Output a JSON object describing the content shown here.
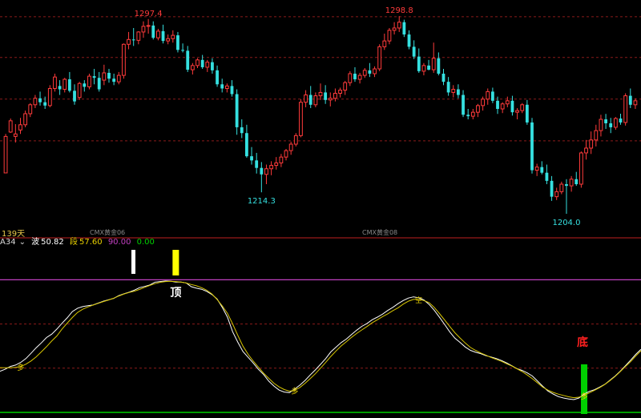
{
  "colors": {
    "up": "#ff3b3b",
    "down": "#35e0e0",
    "wave": "#ffffff",
    "segment": "#d8c600",
    "level90": "#c040c0",
    "level0": "#00d000",
    "grid": "#8b1a1a"
  },
  "header": {
    "indicator_name": "A34",
    "wave_label": "波",
    "wave_value": "50.82",
    "segment_label": "段",
    "segment_value": "57.60",
    "level_high": "90.00",
    "level_low": "0.00"
  },
  "labels": {
    "days": "139天",
    "contract_1": "CMX黄金06",
    "contract_2": "CMX黄金08",
    "top_marker": "顶",
    "bottom_marker": "底",
    "marker_duo": "多",
    "marker_kong": "空"
  },
  "chart_data": [
    {
      "type": "candlestick",
      "title": "",
      "annotations": [
        {
          "label": "1297.4",
          "index": 29,
          "kind": "high"
        },
        {
          "label": "1298.8",
          "index": 80,
          "kind": "high"
        },
        {
          "label": "1214.3",
          "index": 52,
          "kind": "low"
        },
        {
          "label": "1204.0",
          "index": 114,
          "kind": "low"
        }
      ],
      "ylim": [
        1199,
        1305
      ],
      "grid_levels": [
        1298.5,
        1279,
        1259,
        1239
      ],
      "candles": [
        [
          1223.6,
          1242.3,
          1223.6,
          1241.1
        ],
        [
          1243.2,
          1249.7,
          1242.8,
          1248.6
        ],
        [
          1241.1,
          1247.0,
          1238.2,
          1242.3
        ],
        [
          1244.2,
          1250.0,
          1242.3,
          1246.7
        ],
        [
          1246.7,
          1253.5,
          1245.5,
          1252.0
        ],
        [
          1252.0,
          1257.1,
          1250.4,
          1256.3
        ],
        [
          1256.3,
          1261.0,
          1254.7,
          1259.4
        ],
        [
          1259.4,
          1262.6,
          1255.9,
          1257.5
        ],
        [
          1257.5,
          1260.2,
          1254.3,
          1255.9
        ],
        [
          1255.9,
          1265.7,
          1255.1,
          1264.1
        ],
        [
          1264.1,
          1271.2,
          1262.6,
          1269.6
        ],
        [
          1265.3,
          1268.1,
          1261.0,
          1263.7
        ],
        [
          1263.7,
          1269.2,
          1262.2,
          1268.5
        ],
        [
          1268.5,
          1272.0,
          1262.2,
          1263.0
        ],
        [
          1263.0,
          1266.1,
          1256.3,
          1257.9
        ],
        [
          1259.8,
          1267.3,
          1258.6,
          1266.5
        ],
        [
          1266.5,
          1268.1,
          1262.6,
          1264.9
        ],
        [
          1264.9,
          1271.2,
          1263.7,
          1270.0
        ],
        [
          1270.0,
          1273.5,
          1266.1,
          1269.2
        ],
        [
          1269.2,
          1272.0,
          1262.6,
          1263.7
        ],
        [
          1268.1,
          1275.5,
          1265.7,
          1271.6
        ],
        [
          1271.6,
          1273.5,
          1266.9,
          1268.8
        ],
        [
          1268.8,
          1271.2,
          1265.7,
          1267.3
        ],
        [
          1267.3,
          1272.0,
          1266.1,
          1270.4
        ],
        [
          1270.4,
          1285.7,
          1268.8,
          1285.3
        ],
        [
          1285.3,
          1291.2,
          1282.9,
          1287.6
        ],
        [
          1287.6,
          1293.1,
          1284.5,
          1287.2
        ],
        [
          1287.2,
          1291.6,
          1285.3,
          1291.2
        ],
        [
          1291.2,
          1296.3,
          1288.4,
          1293.9
        ],
        [
          1293.9,
          1297.4,
          1290.4,
          1294.3
        ],
        [
          1294.3,
          1296.3,
          1287.6,
          1288.4
        ],
        [
          1288.4,
          1292.7,
          1287.2,
          1291.6
        ],
        [
          1291.6,
          1294.7,
          1285.7,
          1286.9
        ],
        [
          1286.9,
          1290.0,
          1285.3,
          1288.0
        ],
        [
          1288.0,
          1292.0,
          1286.1,
          1289.6
        ],
        [
          1289.6,
          1291.2,
          1281.4,
          1282.6
        ],
        [
          1282.6,
          1285.7,
          1281.4,
          1282.2
        ],
        [
          1282.2,
          1284.5,
          1272.0,
          1273.1
        ],
        [
          1273.1,
          1276.3,
          1270.8,
          1275.1
        ],
        [
          1275.1,
          1278.6,
          1273.9,
          1277.8
        ],
        [
          1277.8,
          1280.2,
          1273.5,
          1274.3
        ],
        [
          1274.3,
          1277.8,
          1272.0,
          1276.7
        ],
        [
          1276.7,
          1278.6,
          1271.2,
          1272.8
        ],
        [
          1272.8,
          1275.1,
          1264.9,
          1266.1
        ],
        [
          1266.1,
          1268.8,
          1262.2,
          1264.1
        ],
        [
          1264.1,
          1266.5,
          1262.2,
          1265.3
        ],
        [
          1265.3,
          1268.1,
          1260.2,
          1261.4
        ],
        [
          1261.4,
          1263.7,
          1241.9,
          1245.5
        ],
        [
          1245.5,
          1249.3,
          1240.3,
          1242.7
        ],
        [
          1242.7,
          1246.7,
          1230.9,
          1231.6
        ],
        [
          1231.6,
          1236.0,
          1227.6,
          1229.6
        ],
        [
          1229.6,
          1233.2,
          1223.3,
          1226.0
        ],
        [
          1226.0,
          1228.8,
          1214.3,
          1222.9
        ],
        [
          1222.9,
          1227.6,
          1218.2,
          1225.6
        ],
        [
          1225.6,
          1229.2,
          1222.5,
          1227.2
        ],
        [
          1227.2,
          1231.2,
          1225.2,
          1228.4
        ],
        [
          1228.4,
          1232.7,
          1226.4,
          1231.2
        ],
        [
          1231.2,
          1235.1,
          1229.6,
          1234.3
        ],
        [
          1234.3,
          1238.6,
          1232.3,
          1237.4
        ],
        [
          1237.4,
          1242.7,
          1236.3,
          1241.5
        ],
        [
          1241.5,
          1259.0,
          1240.7,
          1257.5
        ],
        [
          1257.5,
          1263.3,
          1255.1,
          1261.0
        ],
        [
          1261.0,
          1265.3,
          1254.7,
          1256.3
        ],
        [
          1256.3,
          1262.2,
          1255.1,
          1260.6
        ],
        [
          1260.6,
          1266.5,
          1258.6,
          1262.2
        ],
        [
          1262.2,
          1265.7,
          1256.7,
          1258.6
        ],
        [
          1258.6,
          1262.2,
          1255.5,
          1259.4
        ],
        [
          1259.4,
          1264.1,
          1257.9,
          1261.8
        ],
        [
          1261.8,
          1264.5,
          1259.8,
          1263.3
        ],
        [
          1263.3,
          1267.7,
          1261.0,
          1266.9
        ],
        [
          1266.9,
          1272.4,
          1265.3,
          1271.2
        ],
        [
          1271.2,
          1274.3,
          1267.3,
          1268.5
        ],
        [
          1268.5,
          1271.6,
          1266.5,
          1270.4
        ],
        [
          1270.4,
          1273.9,
          1269.2,
          1272.8
        ],
        [
          1272.8,
          1276.3,
          1269.6,
          1271.2
        ],
        [
          1271.2,
          1274.7,
          1269.6,
          1273.5
        ],
        [
          1273.5,
          1285.3,
          1272.4,
          1284.1
        ],
        [
          1284.1,
          1290.4,
          1282.6,
          1286.9
        ],
        [
          1286.9,
          1293.1,
          1285.3,
          1292.0
        ],
        [
          1292.0,
          1295.9,
          1290.0,
          1293.1
        ],
        [
          1293.1,
          1298.8,
          1291.2,
          1295.9
        ],
        [
          1295.9,
          1297.1,
          1288.8,
          1290.0
        ],
        [
          1290.0,
          1292.0,
          1282.9,
          1284.1
        ],
        [
          1284.1,
          1287.2,
          1278.2,
          1279.4
        ],
        [
          1279.4,
          1283.3,
          1271.6,
          1272.4
        ],
        [
          1272.4,
          1276.3,
          1270.4,
          1275.1
        ],
        [
          1275.1,
          1277.8,
          1272.8,
          1273.1
        ],
        [
          1273.1,
          1286.1,
          1271.6,
          1278.6
        ],
        [
          1278.6,
          1281.4,
          1270.4,
          1271.2
        ],
        [
          1271.2,
          1273.5,
          1265.7,
          1267.3
        ],
        [
          1267.3,
          1269.6,
          1260.6,
          1262.2
        ],
        [
          1262.2,
          1265.7,
          1259.8,
          1263.7
        ],
        [
          1263.7,
          1266.1,
          1259.4,
          1261.0
        ],
        [
          1261.0,
          1263.3,
          1250.4,
          1251.5
        ],
        [
          1251.5,
          1254.3,
          1249.3,
          1250.8
        ],
        [
          1250.8,
          1254.3,
          1249.3,
          1252.7
        ],
        [
          1252.7,
          1256.7,
          1250.4,
          1255.9
        ],
        [
          1255.9,
          1260.2,
          1253.5,
          1259.0
        ],
        [
          1259.0,
          1264.1,
          1256.3,
          1262.6
        ],
        [
          1262.6,
          1264.5,
          1257.1,
          1258.2
        ],
        [
          1258.2,
          1260.2,
          1251.9,
          1254.3
        ],
        [
          1254.3,
          1257.5,
          1252.3,
          1256.7
        ],
        [
          1256.7,
          1260.2,
          1255.1,
          1258.2
        ],
        [
          1258.2,
          1260.6,
          1251.1,
          1252.7
        ],
        [
          1252.7,
          1254.7,
          1249.3,
          1253.5
        ],
        [
          1253.5,
          1257.1,
          1252.3,
          1256.3
        ],
        [
          1256.3,
          1258.6,
          1246.7,
          1247.8
        ],
        [
          1247.8,
          1250.0,
          1223.3,
          1224.9
        ],
        [
          1224.9,
          1228.0,
          1222.1,
          1226.4
        ],
        [
          1226.4,
          1229.2,
          1222.9,
          1223.7
        ],
        [
          1223.7,
          1227.6,
          1218.2,
          1219.8
        ],
        [
          1219.8,
          1222.1,
          1210.2,
          1212.2
        ],
        [
          1212.2,
          1216.5,
          1210.6,
          1214.6
        ],
        [
          1214.6,
          1219.4,
          1213.4,
          1218.2
        ],
        [
          1218.2,
          1220.6,
          1204.0,
          1217.4
        ],
        [
          1217.4,
          1222.1,
          1214.6,
          1220.6
        ],
        [
          1220.6,
          1224.1,
          1217.4,
          1218.2
        ],
        [
          1218.2,
          1233.9,
          1216.5,
          1233.2
        ],
        [
          1233.2,
          1239.4,
          1230.0,
          1235.5
        ],
        [
          1235.5,
          1243.5,
          1232.7,
          1239.4
        ],
        [
          1239.4,
          1246.7,
          1236.3,
          1243.9
        ],
        [
          1243.9,
          1251.5,
          1241.1,
          1249.3
        ],
        [
          1249.3,
          1251.9,
          1244.7,
          1247.4
        ],
        [
          1247.4,
          1250.0,
          1242.7,
          1245.5
        ],
        [
          1245.5,
          1250.4,
          1244.3,
          1249.7
        ],
        [
          1249.7,
          1252.0,
          1246.7,
          1247.8
        ],
        [
          1247.8,
          1261.8,
          1246.3,
          1260.6
        ],
        [
          1260.6,
          1264.1,
          1254.7,
          1256.3
        ],
        [
          1256.3,
          1259.4,
          1254.3,
          1258.2
        ]
      ]
    },
    {
      "type": "line",
      "title": "",
      "ylim": [
        0,
        100
      ],
      "reference_levels": [
        90,
        60,
        30,
        0
      ],
      "series": [
        {
          "name": "波",
          "values": [
            27.9,
            29.3,
            31.2,
            32.1,
            33.9,
            36.5,
            40.1,
            43.9,
            47.2,
            50.8,
            53.1,
            56.6,
            60.5,
            64.2,
            68.4,
            70.7,
            71.8,
            72.4,
            72.9,
            74.2,
            75.5,
            76.4,
            77.4,
            79.3,
            80.5,
            81.6,
            83.0,
            84.7,
            85.5,
            86.5,
            88.4,
            88.8,
            89.2,
            89.1,
            88.4,
            88.5,
            87.9,
            85.3,
            84.3,
            83.6,
            82.1,
            80.0,
            76.9,
            71.3,
            64.6,
            54.8,
            47.6,
            41.3,
            37.4,
            33.5,
            29.2,
            25.7,
            21.2,
            17.9,
            15.1,
            13.8,
            13.4,
            15.8,
            18.5,
            21.6,
            25.4,
            28.8,
            32.6,
            36.5,
            41.1,
            44.3,
            47.4,
            49.8,
            52.9,
            55.8,
            58.4,
            60.4,
            62.9,
            64.7,
            66.7,
            69.2,
            71.3,
            73.8,
            75.9,
            77.6,
            78.4,
            77.8,
            76.3,
            73.3,
            69.4,
            64.6,
            59.8,
            54.7,
            50.4,
            47.5,
            44.4,
            42.1,
            40.8,
            39.9,
            38.5,
            37.6,
            36.6,
            35.2,
            33.6,
            31.7,
            29.7,
            28.5,
            26.8,
            24.7,
            21.2,
            17.7,
            14.5,
            12.5,
            10.7,
            9.8,
            9.1,
            8.7,
            9.8,
            12.4,
            14.3,
            15.4,
            17.2,
            19.0,
            21.9,
            24.7,
            28.0,
            31.7,
            35.5,
            39.4,
            42.8
          ]
        },
        {
          "name": "段",
          "values": [
            30.4,
            30.3,
            30.3,
            30.6,
            31.1,
            32.7,
            34.9,
            37.7,
            41.1,
            44.6,
            48.4,
            51.9,
            56.6,
            60.6,
            64.4,
            67.8,
            70.0,
            71.6,
            72.8,
            74.0,
            75.2,
            76.3,
            77.5,
            79.0,
            80.4,
            81.4,
            82.3,
            83.5,
            84.9,
            86.2,
            87.4,
            88.3,
            88.8,
            89.0,
            88.8,
            88.5,
            87.8,
            86.8,
            85.9,
            84.6,
            82.9,
            80.4,
            76.6,
            72.3,
            67.2,
            60.1,
            52.3,
            45.0,
            39.4,
            34.8,
            30.6,
            26.6,
            23.1,
            19.8,
            17.3,
            15.5,
            14.4,
            15.0,
            16.9,
            19.7,
            22.9,
            26.2,
            30.0,
            33.9,
            38.0,
            41.7,
            45.1,
            48.0,
            50.9,
            53.6,
            56.0,
            58.3,
            60.8,
            62.9,
            65.0,
            66.9,
            69.1,
            71.0,
            73.5,
            75.5,
            76.7,
            76.7,
            75.9,
            74.5,
            71.3,
            67.1,
            62.8,
            58.3,
            54.1,
            50.5,
            47.1,
            44.1,
            42.1,
            40.3,
            38.8,
            37.3,
            36.0,
            34.7,
            33.0,
            31.5,
            29.6,
            27.7,
            25.4,
            22.8,
            20.0,
            17.1,
            15.1,
            13.6,
            12.4,
            11.5,
            10.6,
            10.0,
            10.3,
            11.5,
            13.3,
            15.0,
            16.8,
            18.9,
            21.6,
            24.4,
            27.7,
            31.2,
            34.5,
            38.3,
            41.9
          ]
        }
      ],
      "annotations": [
        {
          "label": "顶",
          "index": 34,
          "color": "#ffff00"
        },
        {
          "label": "底",
          "index": 113,
          "color": "#00e000"
        }
      ]
    }
  ]
}
